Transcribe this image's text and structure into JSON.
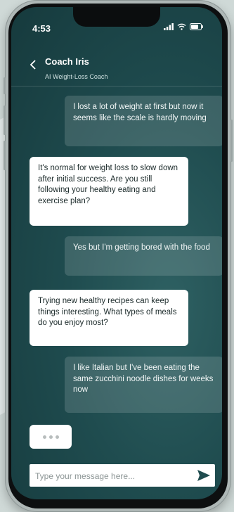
{
  "status_bar": {
    "time": "4:53"
  },
  "header": {
    "title": "Coach Iris",
    "subtitle": "AI Weight-Loss Coach"
  },
  "messages": [
    {
      "from": "user",
      "text": "I lost a lot of weight at first but now it seems like the scale is hardly moving"
    },
    {
      "from": "coach",
      "text": "It's normal for weight loss to slow down after initial success. Are you still following your healthy eating and exercise plan?"
    },
    {
      "from": "user",
      "text": "Yes but I'm getting bored with the food"
    },
    {
      "from": "coach",
      "text": "Trying new healthy recipes can keep things interesting. What types of meals do you enjoy most?"
    },
    {
      "from": "user",
      "text": "I like Italian but I've been eating the same zucchini noodle dishes for weeks now"
    }
  ],
  "composer": {
    "placeholder": "Type your message here..."
  },
  "icons": {
    "back": "chevron-left-icon",
    "send": "send-icon",
    "signal": "signal-icon",
    "wifi": "wifi-icon",
    "battery": "battery-icon"
  },
  "colors": {
    "screen_bg": "#1f4c4f",
    "bot_bubble": "#ffffff",
    "user_bubble": "rgba(255,255,255,0.14)"
  }
}
